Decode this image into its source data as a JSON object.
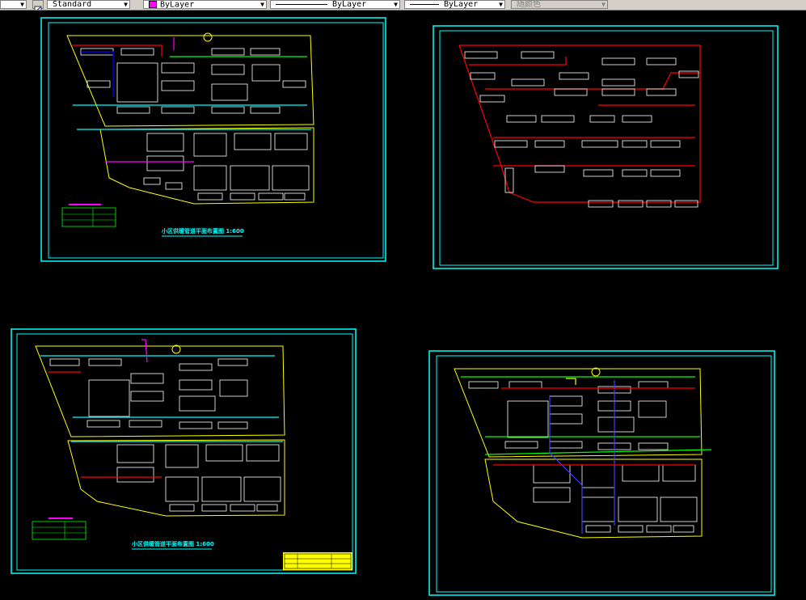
{
  "toolbar": {
    "text_style": "Standard",
    "color_control": "ByLayer",
    "color_swatch": "#ff00ff",
    "linetype_control": "ByLayer",
    "lineweight_control": "ByLayer",
    "plotstyle_control": "随颜色",
    "icons": [
      "dropdown-arrow-icon",
      "text-style-icon"
    ]
  },
  "drawings": {
    "sheet1_title": "小区供暖管道平面布置图 1:600",
    "sheet3_title": "小区供暖管道平面布置图 1:600"
  },
  "colors": {
    "frame": "#00ffff",
    "outline": "#ffff00",
    "pipe_red": "#ff0000",
    "pipe_green": "#00ff00",
    "pipe_blue": "#4040ff",
    "building": "#ffffff",
    "magenta": "#ff00ff"
  }
}
